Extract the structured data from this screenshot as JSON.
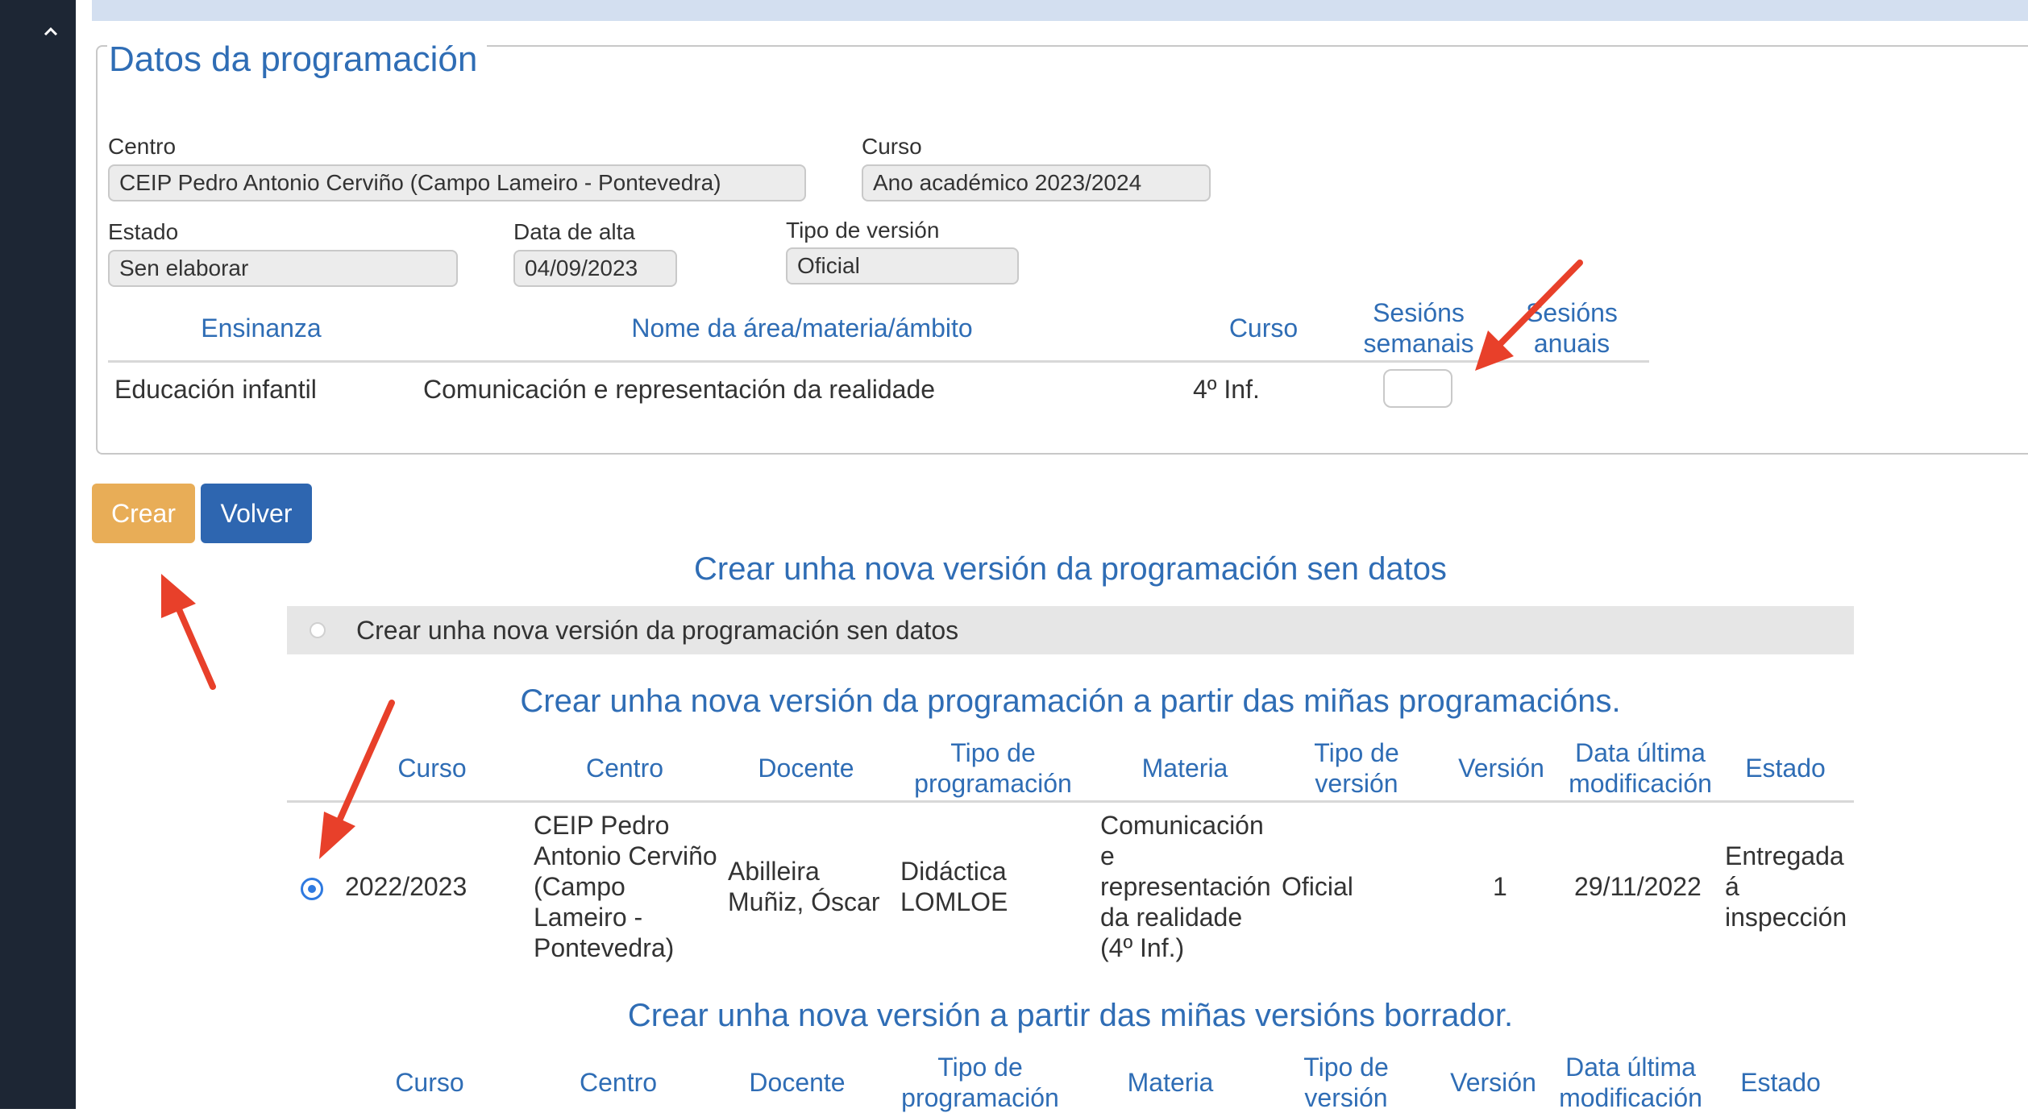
{
  "sidebar": {
    "collapse_icon": "chevron-up-icon"
  },
  "fieldset": {
    "legend": "Datos da programación",
    "centro_label": "Centro",
    "centro_value": "CEIP Pedro Antonio Cerviño (Campo Lameiro - Pontevedra)",
    "curso_label": "Curso",
    "curso_value": "Ano académico 2023/2024",
    "estado_label": "Estado",
    "estado_value": "Sen elaborar",
    "data_alta_label": "Data de alta",
    "data_alta_value": "04/09/2023",
    "tipo_version_label": "Tipo de versión",
    "tipo_version_value": "Oficial"
  },
  "areas_table": {
    "headers": {
      "ensinanza": "Ensinanza",
      "nome": "Nome da área/materia/ámbito",
      "curso": "Curso",
      "sesions_semanais": [
        "Sesións",
        "semanais"
      ],
      "sesions_anuais": [
        "Sesións",
        "anuais"
      ]
    },
    "row": {
      "ensinanza": "Educación infantil",
      "nome": "Comunicación e representación da realidade",
      "curso": "4º Inf.",
      "sesions_semanais": ""
    }
  },
  "buttons": {
    "crear": "Crear",
    "volver": "Volver"
  },
  "sections": {
    "sen_datos_title": "Crear unha nova versión da programación sen datos",
    "sen_datos_option": "Crear unha nova versión da programación sen datos",
    "programacions_title": "Crear unha nova versión da programación a partir das miñas programacións.",
    "borrador_title": "Crear unha nova versión a partir das miñas versións borrador."
  },
  "programs_table": {
    "headers": {
      "curso": "Curso",
      "centro": "Centro",
      "docente": "Docente",
      "tipo_programacion": [
        "Tipo de",
        "programación"
      ],
      "materia": "Materia",
      "tipo_version": [
        "Tipo de",
        "versión"
      ],
      "version": "Versión",
      "data_ultima": [
        "Data última",
        "modificación"
      ],
      "estado": "Estado"
    },
    "rows": [
      {
        "selected": true,
        "curso": "2022/2023",
        "centro": [
          "CEIP Pedro",
          "Antonio Cerviño",
          "(Campo",
          "Lameiro -",
          "Pontevedra)"
        ],
        "docente": [
          "Abilleira",
          "Muñiz, Óscar"
        ],
        "tipo_programacion": [
          "Didáctica",
          "LOMLOE"
        ],
        "materia": [
          "Comunicación",
          "e",
          "representación",
          "da realidade",
          "(4º Inf.)"
        ],
        "tipo_version": "Oficial",
        "version": "1",
        "data_ultima": "29/11/2022",
        "estado": [
          "Entregada",
          "á",
          "inspección"
        ]
      }
    ]
  },
  "borrador_table": {
    "headers": {
      "curso": "Curso",
      "centro": "Centro",
      "docente": "Docente",
      "tipo_programacion": [
        "Tipo de",
        "programación"
      ],
      "materia": "Materia",
      "tipo_version": [
        "Tipo de",
        "versión"
      ],
      "version": "Versión",
      "data_ultima": [
        "Data última",
        "modificación"
      ],
      "estado": "Estado"
    }
  },
  "annotations": {
    "arrow_color": "#e8402a"
  }
}
